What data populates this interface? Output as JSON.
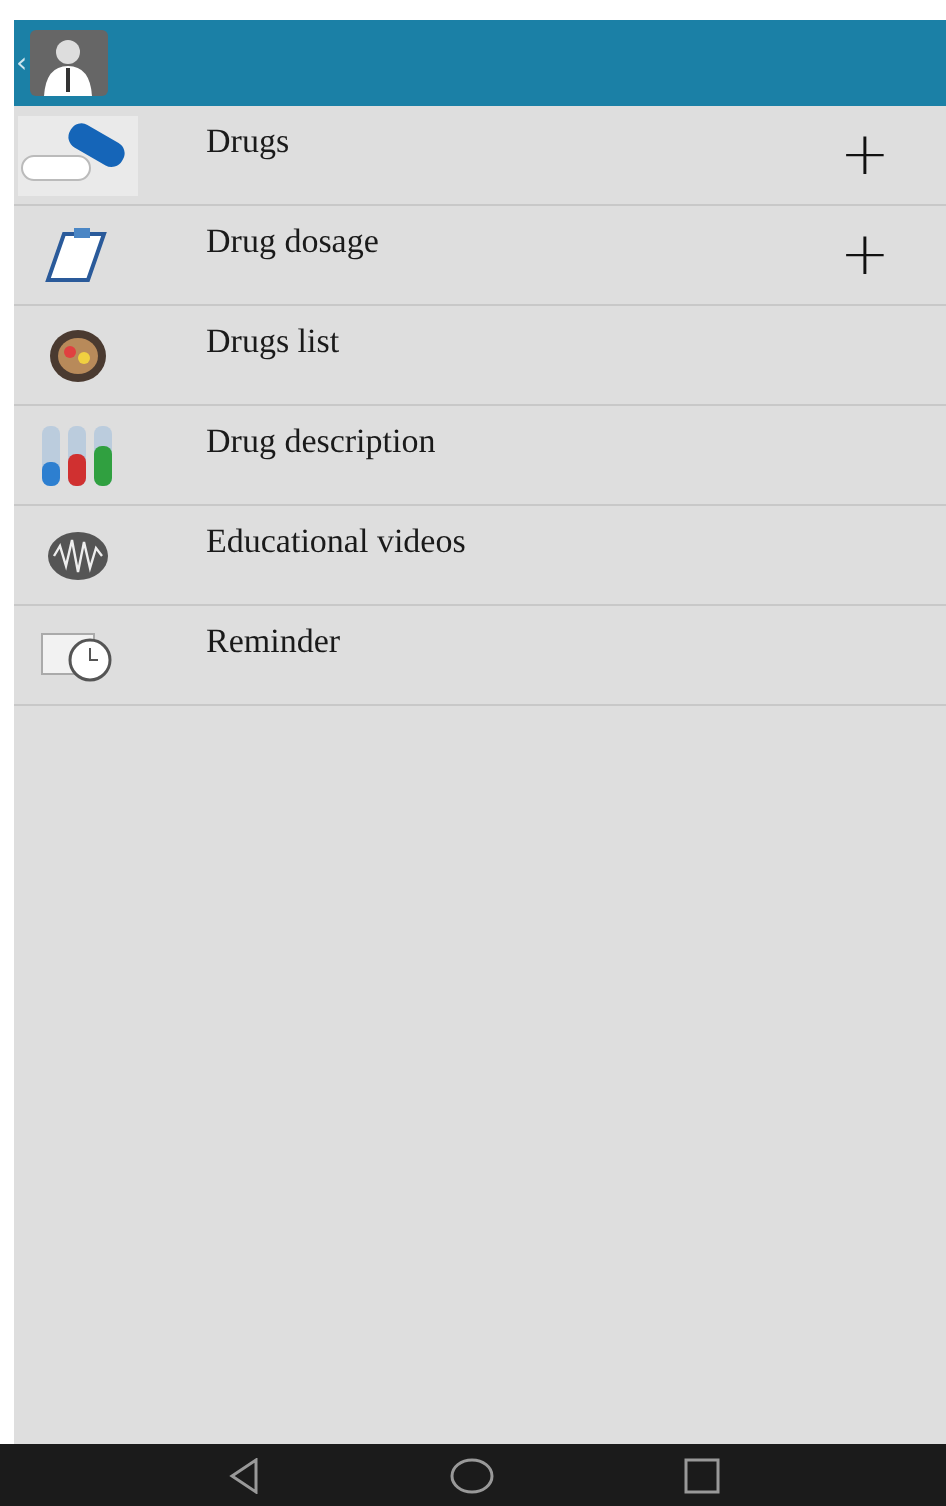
{
  "app_bar": {
    "back": "‹"
  },
  "menu": [
    {
      "label": "Drugs",
      "expand": "+"
    },
    {
      "label": "Drug dosage",
      "expand": "+"
    },
    {
      "label": "Drugs list"
    },
    {
      "label": "Drug description"
    },
    {
      "label": "Educational videos"
    },
    {
      "label": "Reminder"
    }
  ]
}
